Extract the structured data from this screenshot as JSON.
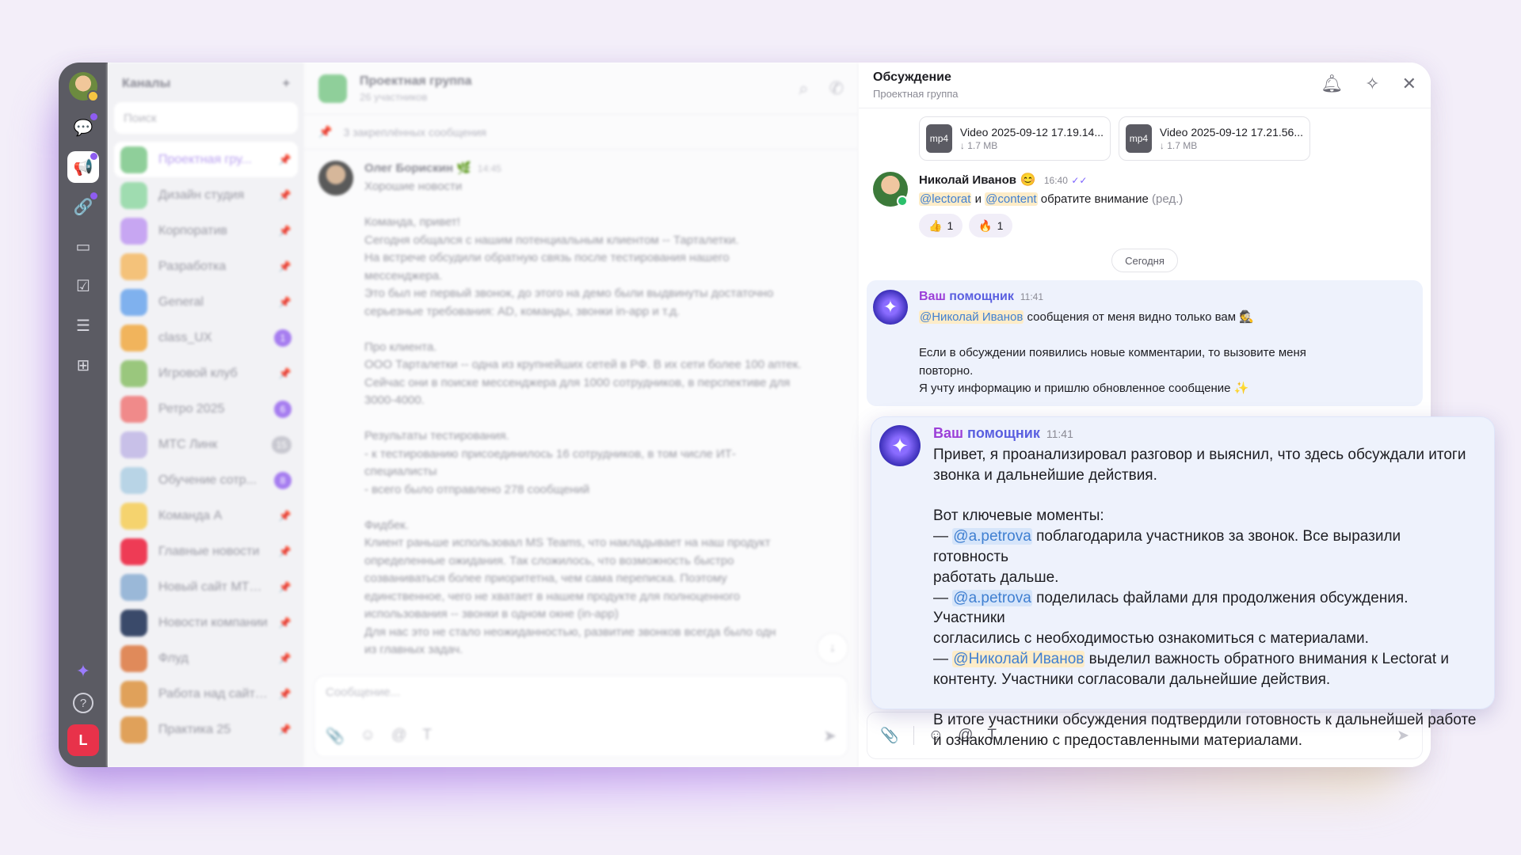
{
  "channels_panel": {
    "title": "Каналы",
    "search_placeholder": "Поиск",
    "items": [
      {
        "name": "Проектная гру...",
        "color": "#8fcf9a",
        "badge": "",
        "active": true
      },
      {
        "name": "Дизайн студия",
        "color": "#9fdcb0",
        "badge": ""
      },
      {
        "name": "Корпоратив",
        "color": "#c7a6f2",
        "badge": ""
      },
      {
        "name": "Разработка",
        "color": "#f4c27a",
        "badge": ""
      },
      {
        "name": "General",
        "color": "#7fb1ee",
        "badge": ""
      },
      {
        "name": "class_UX",
        "color": "#f1b45c",
        "badge": "1"
      },
      {
        "name": "Игровой клуб",
        "color": "#9ac77d",
        "badge": ""
      },
      {
        "name": "Ретро 2025",
        "color": "#f08a8a",
        "badge": "6"
      },
      {
        "name": "МТС Линк",
        "color": "#c8c0e8",
        "badge": "15",
        "badge_grey": true
      },
      {
        "name": "Обучение сотр...",
        "color": "#b8d4e6",
        "badge": "8"
      },
      {
        "name": "Команда А",
        "color": "#f5d36e",
        "badge": ""
      },
      {
        "name": "Главные новости",
        "color": "#ee3b55",
        "badge": ""
      },
      {
        "name": "Новый сайт МТС ...",
        "color": "#9ab8d8",
        "badge": ""
      },
      {
        "name": "Новости компании",
        "color": "#3a4a6a",
        "badge": ""
      },
      {
        "name": "Флуд",
        "color": "#e08a5a",
        "badge": ""
      },
      {
        "name": "Работа над сайтом",
        "color": "#e0a15a",
        "badge": ""
      },
      {
        "name": "Практика 25",
        "color": "#e0a15a",
        "badge": ""
      }
    ]
  },
  "chat": {
    "title": "Проектная группа",
    "subtitle": "26 участников",
    "pinned": "3 закреплённых сообщения",
    "author": "Олег Борискин",
    "time": "14:45",
    "text": "Хорошие новости\n\nКоманда, привет!\nСегодня общался с нашим потенциальным клиентом -- Тарталетки.\nНа встрече обсудили обратную связь после тестирования нашего\nмессенджера.\nЭто был не первый звонок, до этого на демо были выдвинуты достаточно\nсерьезные требования: AD, команды, звонки in-app и т.д.\n\nПро клиента.\nООО Тарталетки -- одна из крупнейших сетей в РФ. В их сети более 100 аптек.\nСейчас они в поиске мессенджера для 1000 сотрудников, в перспективе для\n3000-4000.\n\nРезультаты тестирования.\n- к тестированию присоединилось 16 сотрудников, в том числе ИТ-\nспециалисты\n- всего было отправлено 278 сообщений\n\nФидбек.\nКлиент раньше использовал MS Teams, что накладывает на наш продукт\nопределенные ожидания. Так сложилось, что возможность быстро\nсозваниваться более приоритетна, чем сама переписка. Поэтому\nединственное, чего не хватает в нашем продукте для полноценного\nиспользования -- звонки в одном окне (in-app)\nДля нас это не стало неожиданностью, развитие звонков всегда было одн\nиз главных задач.",
    "composer_placeholder": "Сообщение..."
  },
  "discussion": {
    "title": "Обсуждение",
    "subtitle": "Проектная группа",
    "files": [
      {
        "ext": "mp4",
        "name": "Video 2025-09-12 17.19.14...",
        "size": "1.7 MB"
      },
      {
        "ext": "mp4",
        "name": "Video 2025-09-12 17.21.56...",
        "size": "1.7 MB"
      }
    ],
    "message": {
      "author": "Николай Иванов",
      "time": "16:40",
      "mention1": "@lectorat",
      "and": "и",
      "mention2": "@content",
      "text": "обратите внимание",
      "edited": "(ред.)",
      "reactions": [
        {
          "emoji": "👍",
          "count": "1"
        },
        {
          "emoji": "🔥",
          "count": "1"
        }
      ]
    },
    "date_chip": "Сегодня",
    "assistant1": {
      "name_part1": "Ваш",
      "name_part2": "помощник",
      "time": "11:41",
      "mention": "@Николай Иванов",
      "line1": "сообщения от меня видно только вам 🕵️",
      "body": "Если в обсуждении появились новые комментарии, то вызовите меня\nповторно.\nЯ учту информацию и пришлю обновленное сообщение ✨"
    },
    "composer_icons": [
      "paperclip-icon",
      "smile-icon",
      "at-icon",
      "text-format-icon",
      "send-icon"
    ]
  },
  "assistant_card": {
    "name_part1": "Ваш",
    "name_part2": "помощник",
    "time": "11:41",
    "intro": "Привет, я проанализировал разговор и выяснил, что здесь обсуждали итоги\nзвонка и дальнейшие действия.",
    "key_title": "Вот ключевые моменты:",
    "points": [
      {
        "dash": "—",
        "mention": "@a.petrova",
        "text": "поблагодарила участников за звонок. Все выразили готовность\nработать дальше."
      },
      {
        "dash": "—",
        "mention": "@a.petrova",
        "text": "поделилась файлами для продолжения обсуждения. Участники\nсогласились с необходимостью ознакомиться с материалами."
      },
      {
        "dash": "—",
        "mention": "@Николай Иванов",
        "text": "выделил важность обратного внимания к Lectorat и\nконтенту. Участники согласовали дальнейшие действия."
      }
    ],
    "summary": "В итоге участники обсуждения подтвердили готовность к дальнейшей работе\nи ознакомлению с предоставленными материалами."
  }
}
